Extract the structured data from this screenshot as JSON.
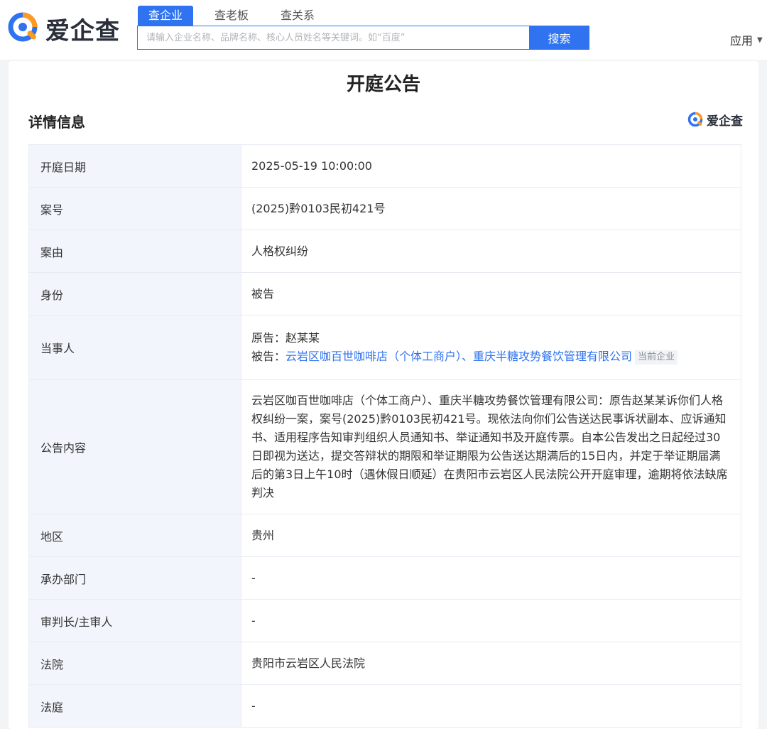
{
  "brand": {
    "name": "爱企查",
    "accent": "#2f73f0",
    "logo_orange": "#ff9a1f"
  },
  "nav": {
    "tabs": [
      "查企业",
      "查老板",
      "查关系"
    ],
    "active_tab": 0,
    "search_placeholder": "请输入企业名称、品牌名称、核心人员姓名等关键词。如“百度”",
    "search_button": "搜索",
    "app_menu": "应用"
  },
  "page": {
    "title": "开庭公告",
    "section_title": "详情信息"
  },
  "detail": {
    "hearing_date": {
      "label": "开庭日期",
      "value": "2025-05-19 10:00:00"
    },
    "case_no": {
      "label": "案号",
      "value": "(2025)黔0103民初421号"
    },
    "cause": {
      "label": "案由",
      "value": "人格权纠纷"
    },
    "identity": {
      "label": "身份",
      "value": "被告"
    },
    "parties": {
      "label": "当事人",
      "plaintiff_prefix": "原告：",
      "plaintiff": "赵某某",
      "defendant_prefix": "被告：",
      "defendant_1": "云岩区咖百世咖啡店（个体工商户）",
      "separator": "、",
      "defendant_2": "重庆半糖攻势餐饮管理有限公司",
      "current_tag": "当前企业"
    },
    "content": {
      "label": "公告内容",
      "value": "云岩区咖百世咖啡店（个体工商户）、重庆半糖攻势餐饮管理有限公司：原告赵某某诉你们人格权纠纷一案，案号(2025)黔0103民初421号。现依法向你们公告送达民事诉状副本、应诉通知书、适用程序告知审判组织人员通知书、举证通知书及开庭传票。自本公告发出之日起经过30日即视为送达，提交答辩状的期限和举证期限为公告送达期满后的15日内，并定于举证期届满后的第3日上午10时（遇休假日顺延）在贵阳市云岩区人民法院公开开庭审理，逾期将依法缺席判决"
    },
    "region": {
      "label": "地区",
      "value": "贵州"
    },
    "department": {
      "label": "承办部门",
      "value": "-"
    },
    "judge": {
      "label": "审判长/主审人",
      "value": "-"
    },
    "court": {
      "label": "法院",
      "value": "贵阳市云岩区人民法院"
    },
    "courtroom": {
      "label": "法庭",
      "value": "-"
    }
  }
}
